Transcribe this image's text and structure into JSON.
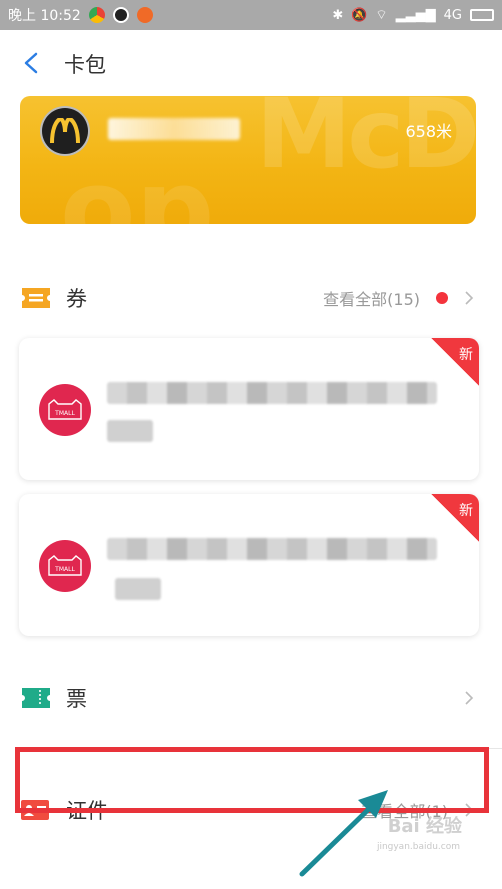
{
  "status_bar": {
    "time": "晚上 10:52",
    "network": "4G",
    "colors": {
      "background": "#a9a9a9"
    },
    "app_icons": [
      "chrome-like-icon",
      "qq-penguin-icon",
      "orange-app-icon"
    ]
  },
  "header": {
    "title": "卡包",
    "back_icon": "chevron-left-icon"
  },
  "mcd_card": {
    "logo": "mcdonalds-logo",
    "distance": "658米",
    "watermark_text": "McD",
    "colors": {
      "accent": "#f3b514",
      "logo_bg": "#1f1f1f",
      "logo_arch": "#f6c230"
    }
  },
  "coupons": {
    "label": "券",
    "view_all": "查看全部(15)",
    "icon": "ticket-icon",
    "colors": {
      "icon": "#f5a623",
      "badge": "#f4333c"
    }
  },
  "coupon_cards": [
    {
      "logo_text": "TMALL",
      "badge": "新"
    },
    {
      "logo_text": "TMALL",
      "badge": "新"
    }
  ],
  "tickets": {
    "label": "票",
    "icon": "ticket-stub-icon",
    "colors": {
      "icon": "#1fab89"
    }
  },
  "ids": {
    "label": "证件",
    "view_all": "查看全部(1)",
    "icon": "id-card-icon",
    "colors": {
      "icon": "#f04b3f",
      "highlight": "#e8333a"
    }
  },
  "watermark": {
    "brand": "Bai 经验",
    "url": "jingyan.baidu.com"
  }
}
